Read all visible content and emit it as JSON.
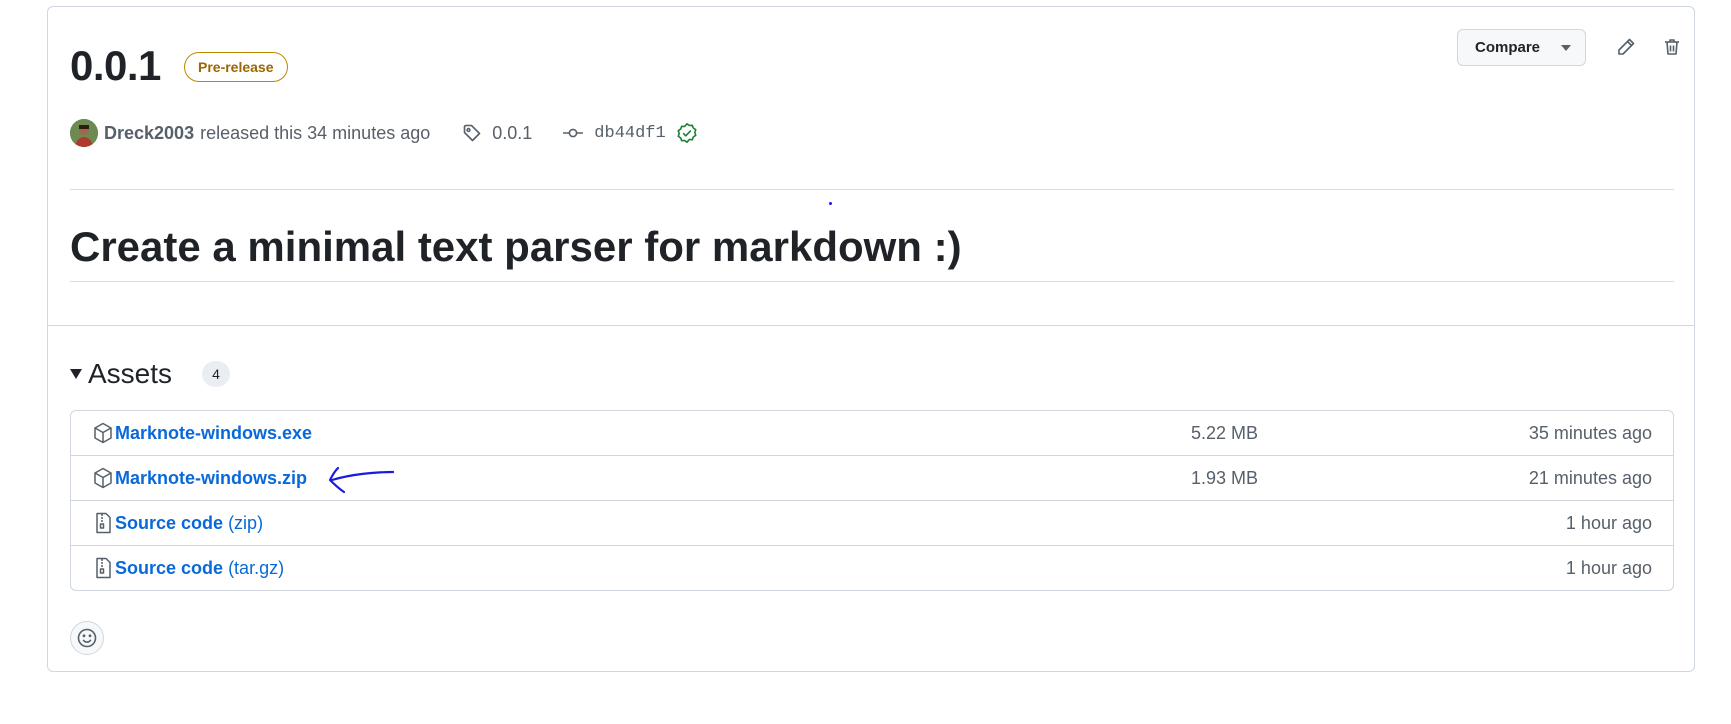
{
  "release": {
    "version": "0.0.1",
    "badge": "Pre-release",
    "compare_label": "Compare",
    "author": "Dreck2003",
    "released_text": "released this 34 minutes ago",
    "tag": "0.0.1",
    "commit": "db44df1",
    "title": "Create a minimal text parser for markdown :)"
  },
  "assets": {
    "heading": "Assets",
    "count": "4",
    "items": [
      {
        "name": "Marknote-windows.exe",
        "suffix": "",
        "size": "5.22 MB",
        "time": "35 minutes ago",
        "icon": "package-icon"
      },
      {
        "name": "Marknote-windows.zip",
        "suffix": "",
        "size": "1.93 MB",
        "time": "21 minutes ago",
        "icon": "package-icon"
      },
      {
        "name": "Source code",
        "suffix": "(zip)",
        "size": "",
        "time": "1 hour ago",
        "icon": "file-zip-icon"
      },
      {
        "name": "Source code",
        "suffix": "(tar.gz)",
        "size": "",
        "time": "1 hour ago",
        "icon": "file-zip-icon"
      }
    ]
  },
  "colors": {
    "link": "#0969da",
    "badge": "#9a6700",
    "verified": "#1a7f37",
    "annotation": "#1a1adc"
  }
}
